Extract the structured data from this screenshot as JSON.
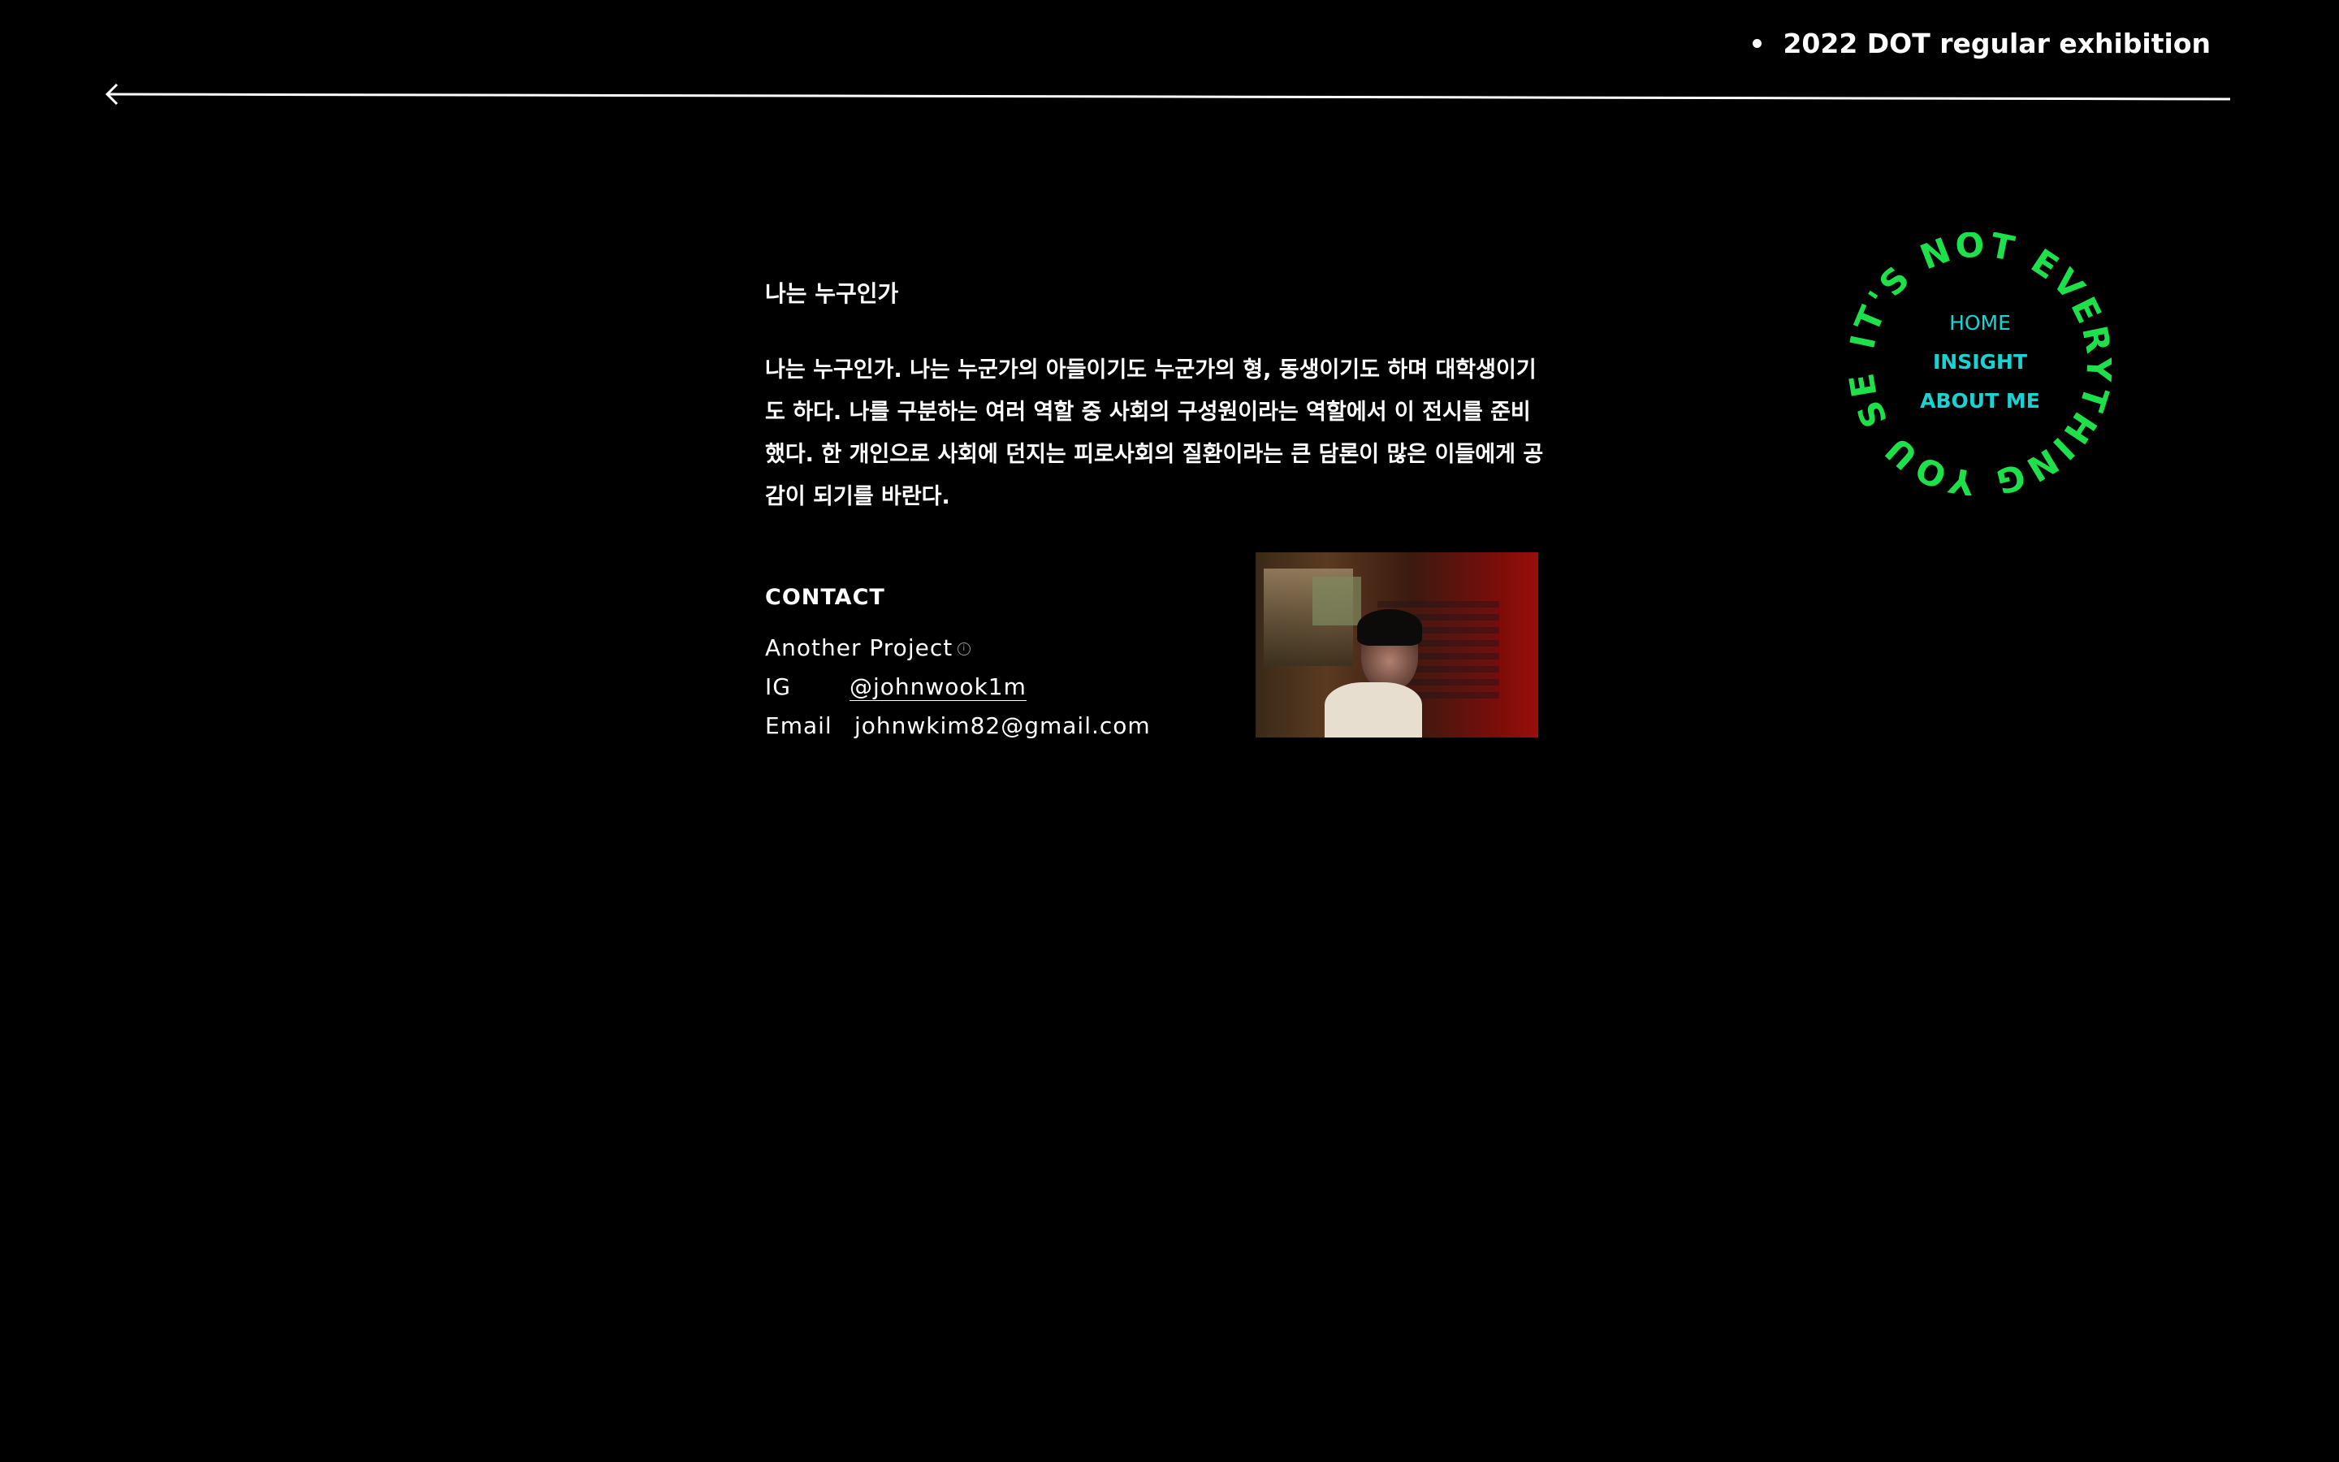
{
  "header": {
    "title": "2022 DOT regular exhibition",
    "back_icon": "arrow-left-icon"
  },
  "about": {
    "heading": "나는 누구인가",
    "body": "나는 누구인가. 나는 누군가의 아들이기도 누군가의 형, 동생이기도 하며 대학생이기도 하다. 나를 구분하는 여러 역할 중 사회의 구성원이라는 역할에서 이 전시를 준비했다. 한 개인으로 사회에 던지는 피로사회의 질환이라는 큰 담론이 많은 이들에게 공감이 되기를 바란다."
  },
  "contact": {
    "heading": "CONTACT",
    "project_label": "Another Project",
    "project_icon": "info-icon",
    "ig_label": "IG",
    "ig_value": "@johnwook1m",
    "email_label": "Email",
    "email_value": "johnwkim82@gmail.com"
  },
  "nav": {
    "ring_text": "IT'S NOT EVERYTHING YOU SEE",
    "items": [
      {
        "label": "HOME"
      },
      {
        "label": "INSIGHT"
      },
      {
        "label": "ABOUT ME"
      }
    ]
  },
  "colors": {
    "background": "#000000",
    "text": "#ffffff",
    "ring": "#1ee04a",
    "nav": "#19d3d3"
  }
}
